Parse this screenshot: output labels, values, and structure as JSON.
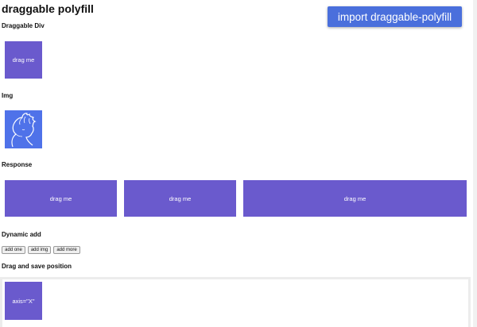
{
  "page": {
    "title": "draggable polyfill"
  },
  "toolbar": {
    "import_label": "import draggable-polyfill"
  },
  "sections": {
    "draggable_div": {
      "title": "Draggable Div",
      "box_label": "drag me"
    },
    "img": {
      "title": "Img"
    },
    "response": {
      "title": "Response",
      "boxes": [
        "drag me",
        "drag me",
        "drag me"
      ]
    },
    "dynamic_add": {
      "title": "Dynamic add",
      "buttons": [
        "add one",
        "add img",
        "add more"
      ]
    },
    "save_position": {
      "title": "Drag and save position",
      "box_label": "axis=\"X\""
    }
  },
  "colors": {
    "box": "#6a5acd",
    "image_bg": "#4f72e9",
    "button": "#4a6fdc"
  }
}
